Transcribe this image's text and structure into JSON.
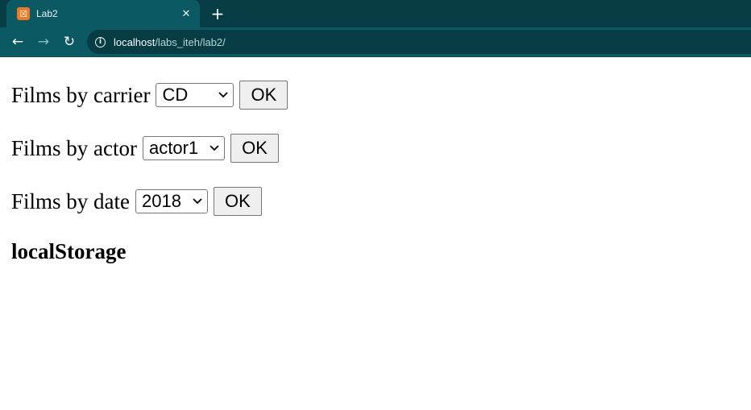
{
  "browser": {
    "tab_title": "Lab2",
    "tab_close": "✕",
    "new_tab": "+",
    "url_host": "localhost",
    "url_path": "/labs_iteh/lab2/",
    "icons": {
      "favicon": "xampp-icon",
      "close": "close-icon",
      "new_tab": "plus-icon",
      "back": "back-arrow-icon",
      "forward": "forward-arrow-icon",
      "reload": "reload-icon",
      "info": "info-icon"
    }
  },
  "filters": [
    {
      "label": "Films by carrier",
      "selected": "CD",
      "button": "OK"
    },
    {
      "label": "Films by actor",
      "selected": "actor1",
      "button": "OK"
    },
    {
      "label": "Films by date",
      "selected": "2018",
      "button": "OK"
    }
  ],
  "section_heading": "localStorage"
}
